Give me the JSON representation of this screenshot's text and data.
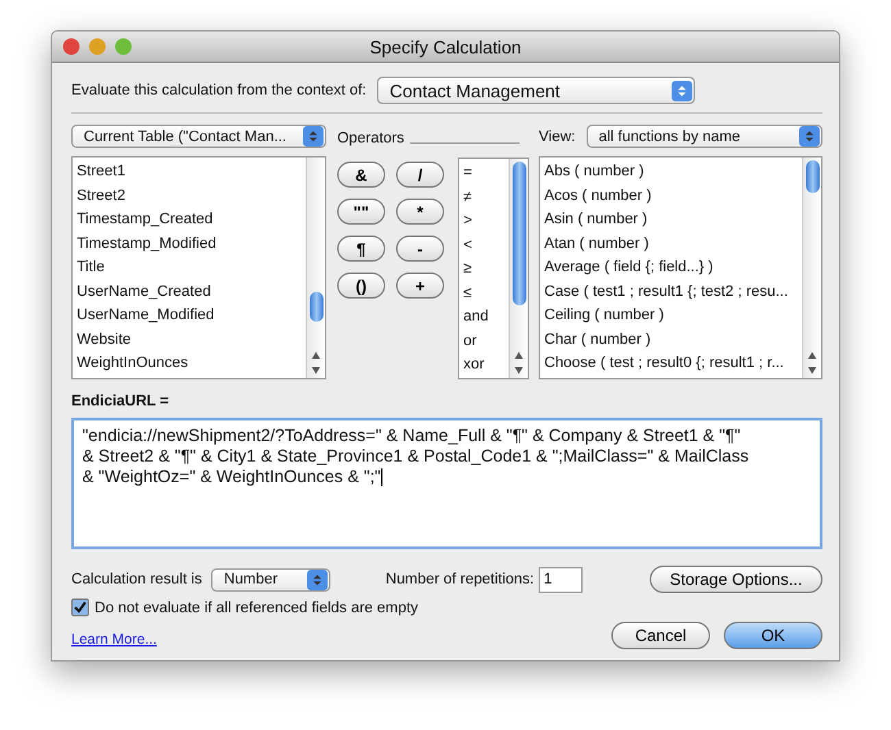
{
  "window": {
    "title": "Specify Calculation"
  },
  "context": {
    "label": "Evaluate this calculation from the context of:",
    "value": "Contact Management"
  },
  "table_popup": {
    "value": "Current Table (\"Contact Man..."
  },
  "fields": [
    "Street1",
    "Street2",
    "Timestamp_Created",
    "Timestamp_Modified",
    "Title",
    "UserName_Created",
    "UserName_Modified",
    "Website",
    "WeightInOunces"
  ],
  "operators": {
    "label": "Operators",
    "buttons": [
      "&",
      "/",
      "\"\"",
      "*",
      "¶",
      "-",
      "()",
      "+"
    ],
    "list": [
      "=",
      "≠",
      ">",
      "<",
      "≥",
      "≤",
      "and",
      "or",
      "xor"
    ]
  },
  "view": {
    "label": "View:",
    "value": "all functions by name"
  },
  "functions": [
    "Abs ( number )",
    "Acos ( number )",
    "Asin ( number )",
    "Atan ( number )",
    "Average ( field {; field...} )",
    "Case ( test1 ; result1 {; test2 ; resu...",
    "Ceiling ( number )",
    "Char ( number )",
    "Choose ( test ; result0 {; result1 ; r..."
  ],
  "formula": {
    "label": "EndiciaURL =",
    "lines": [
      "\"endicia://newShipment2/?ToAddress=\" & Name_Full & \"¶\"  & Company  & Street1  &  \"¶\"",
      "& Street2  & \"¶\"  & City1  & State_Province1  & Postal_Code1 & \";MailClass=\" & MailClass",
      "& \"WeightOz=\" & WeightInOunces & \";\""
    ]
  },
  "result": {
    "label": "Calculation result is",
    "value": "Number"
  },
  "repetitions": {
    "label": "Number of repetitions:",
    "value": "1"
  },
  "storage_button": "Storage Options...",
  "do_not_evaluate": {
    "label": "Do not evaluate if all referenced fields are empty",
    "checked": true
  },
  "learn_more": "Learn More...",
  "buttons": [
    {
      "label": "Cancel",
      "default": false
    },
    {
      "label": "OK",
      "default": true
    }
  ]
}
